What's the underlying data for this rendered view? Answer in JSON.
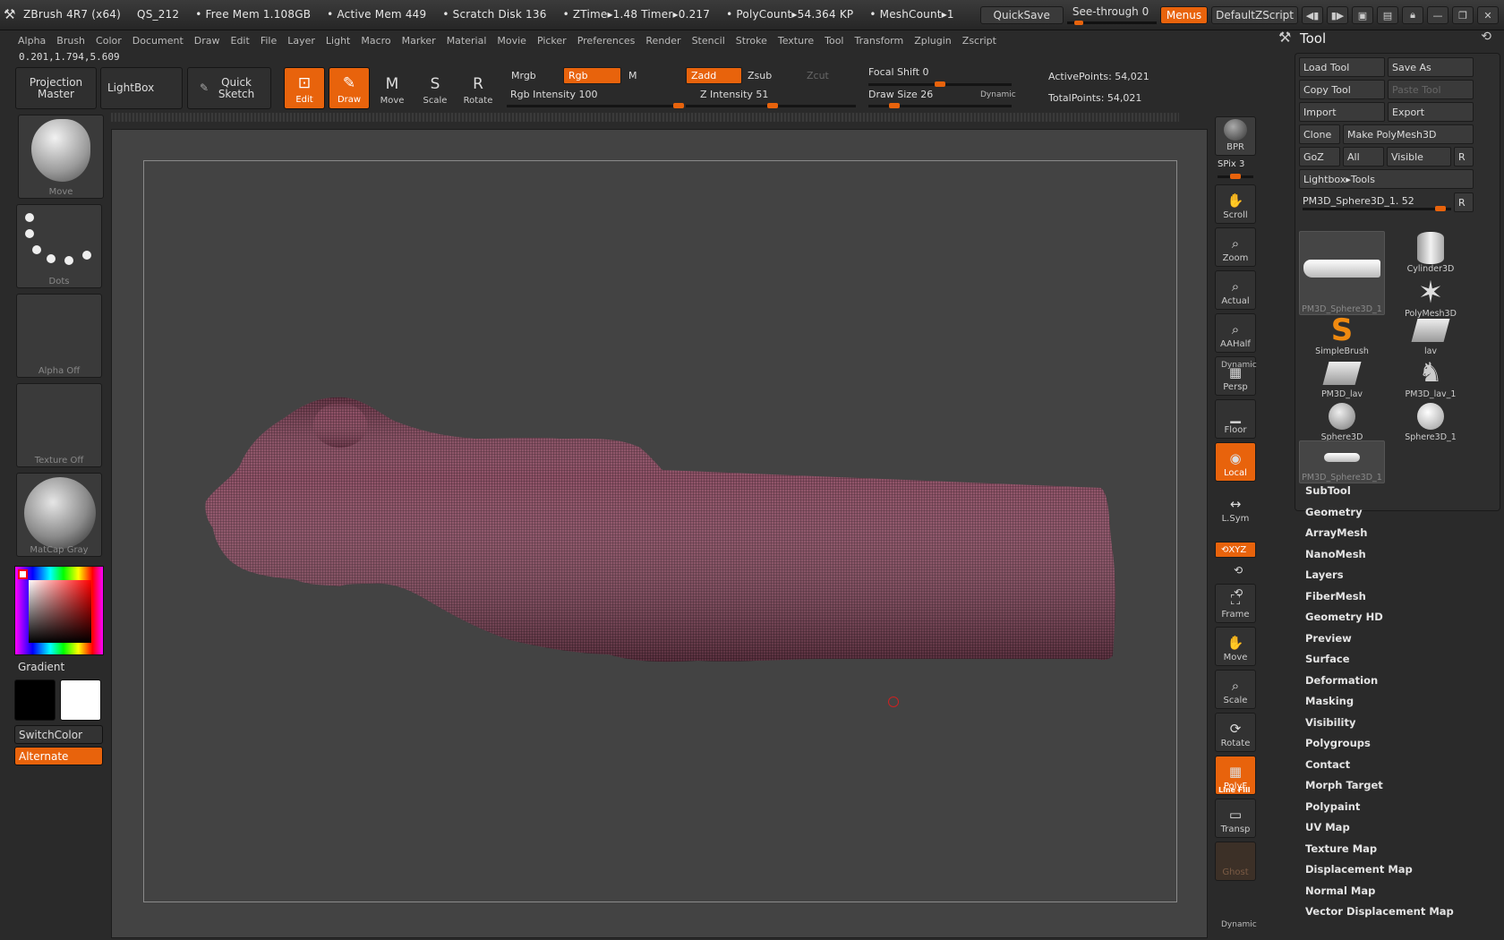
{
  "titlebar": {
    "app": "ZBrush 4R7 (x64)",
    "doc": "QS_212",
    "free_mem": "• Free Mem 1.108GB",
    "active_mem": "• Active Mem 449",
    "scratch": "• Scratch Disk 136",
    "ztime": "• ZTime▸1.48 Timer▸0.217",
    "polycount": "• PolyCount▸54.364 KP",
    "meshcount": "• MeshCount▸1",
    "quicksave": "QuickSave",
    "see_through": "See-through  0",
    "see_through_value": 0,
    "menus": "Menus",
    "script": "DefaultZScript"
  },
  "menubar": [
    "Alpha",
    "Brush",
    "Color",
    "Document",
    "Draw",
    "Edit",
    "File",
    "Layer",
    "Light",
    "Macro",
    "Marker",
    "Material",
    "Movie",
    "Picker",
    "Preferences",
    "Render",
    "Stencil",
    "Stroke",
    "Texture",
    "Tool",
    "Transform",
    "Zplugin",
    "Zscript"
  ],
  "coords": "0.201,1.794,5.609",
  "shelf": {
    "projection_master": "Projection Master",
    "lightbox": "LightBox",
    "quick_sketch": "Quick Sketch",
    "tools": [
      {
        "label": "Edit",
        "icon": "edit-icon",
        "glyph": "⊡",
        "active": true
      },
      {
        "label": "Draw",
        "icon": "draw-icon",
        "glyph": "✎",
        "active": true
      },
      {
        "label": "Move",
        "icon": "move-icon",
        "glyph": "M",
        "active": false
      },
      {
        "label": "Scale",
        "icon": "scale-icon",
        "glyph": "S",
        "active": false
      },
      {
        "label": "Rotate",
        "icon": "rotate-icon",
        "glyph": "R",
        "active": false
      }
    ]
  },
  "params": {
    "mrgb": "Mrgb",
    "rgb": "Rgb",
    "m": "M",
    "zadd": "Zadd",
    "zsub": "Zsub",
    "zcut": "Zcut",
    "rgb_intensity": "Rgb Intensity 100",
    "rgb_intensity_value": 100,
    "z_intensity": "Z Intensity 51",
    "z_intensity_value": 51,
    "focal_shift": "Focal Shift 0",
    "focal_shift_value": 0,
    "draw_size": "Draw Size 26",
    "draw_size_value": 26,
    "dynamic": "Dynamic",
    "active_points": "ActivePoints: 54,021",
    "total_points": "TotalPoints: 54,021"
  },
  "left": {
    "brush": "Move",
    "stroke": "Dots",
    "alpha": "Alpha  Off",
    "texture": "Texture  Off",
    "material": "MatCap  Gray",
    "gradient": "Gradient",
    "switch_color": "SwitchColor",
    "alternate": "Alternate",
    "primary_color": "#000000",
    "secondary_color": "#ffffff"
  },
  "dock": {
    "bpr": "BPR",
    "spix": "SPix 3",
    "buttons": [
      {
        "label": "Scroll",
        "icon": "scroll-icon",
        "glyph": "✋"
      },
      {
        "label": "Zoom",
        "icon": "zoom-icon",
        "glyph": "⌕"
      },
      {
        "label": "Actual",
        "icon": "actual-icon",
        "glyph": "⌕"
      },
      {
        "label": "AAHalf",
        "icon": "aahalf-icon",
        "glyph": "⌕"
      },
      {
        "label": "Persp",
        "icon": "persp-icon",
        "glyph": "▦"
      },
      {
        "label": "Floor",
        "icon": "floor-icon",
        "glyph": "▁"
      },
      {
        "label": "Local",
        "icon": "local-icon",
        "glyph": "◉"
      },
      {
        "label": "L.Sym",
        "icon": "lsym-icon",
        "glyph": "↔"
      },
      {
        "label": "Frame",
        "icon": "frame-icon",
        "glyph": "⛶"
      },
      {
        "label": "Move",
        "icon": "move-view-icon",
        "glyph": "✋"
      },
      {
        "label": "Scale",
        "icon": "scale-view-icon",
        "glyph": "⌕"
      },
      {
        "label": "Rotate",
        "icon": "rotate-view-icon",
        "glyph": "⟳"
      },
      {
        "label": "PolyF",
        "icon": "polyf-icon",
        "glyph": "▦"
      },
      {
        "label": "Transp",
        "icon": "transp-icon",
        "glyph": "▭"
      },
      {
        "label": "Ghost",
        "icon": "ghost-icon",
        "glyph": ""
      }
    ],
    "dynamic": "Dynamic",
    "xyz": "⟲XYZ",
    "linefill": "Line Fill"
  },
  "tool": {
    "title": "Tool",
    "load_tool": "Load Tool",
    "save_as": "Save As",
    "copy_tool": "Copy Tool",
    "paste_tool": "Paste Tool",
    "import": "Import",
    "export": "Export",
    "clone": "Clone",
    "make_polymesh": "Make PolyMesh3D",
    "goz": "GoZ",
    "all": "All",
    "visible": "Visible",
    "r": "R",
    "lightbox_tools": "Lightbox▸Tools",
    "current_tool": "PM3D_Sphere3D_1. 52",
    "current_tool_value": 52,
    "items": [
      {
        "label": "PM3D_Sphere3D_1",
        "icon": "current-mesh-icon"
      },
      {
        "label": "Cylinder3D",
        "icon": "cylinder-icon"
      },
      {
        "label": "PolyMesh3D",
        "icon": "polymesh-star-icon"
      },
      {
        "label": "SimpleBrush",
        "icon": "simplebrush-icon"
      },
      {
        "label": "lav",
        "icon": "lav-icon"
      },
      {
        "label": "PM3D_lav",
        "icon": "pm3d-lav-icon"
      },
      {
        "label": "PM3D_lav_1",
        "icon": "pm3d-lav1-icon"
      },
      {
        "label": "Sphere3D",
        "icon": "sphere-icon"
      },
      {
        "label": "Sphere3D_1",
        "icon": "sphere1-icon"
      },
      {
        "label": "PM3D_Sphere3D_1",
        "icon": "mesh-thumb-icon"
      }
    ],
    "subpalettes": [
      "SubTool",
      "Geometry",
      "ArrayMesh",
      "NanoMesh",
      "Layers",
      "FiberMesh",
      "Geometry HD",
      "Preview",
      "Surface",
      "Deformation",
      "Masking",
      "Visibility",
      "Polygroups",
      "Contact",
      "Morph Target",
      "Polypaint",
      "UV Map",
      "Texture Map",
      "Displacement Map",
      "Normal Map",
      "Vector Displacement Map"
    ]
  }
}
